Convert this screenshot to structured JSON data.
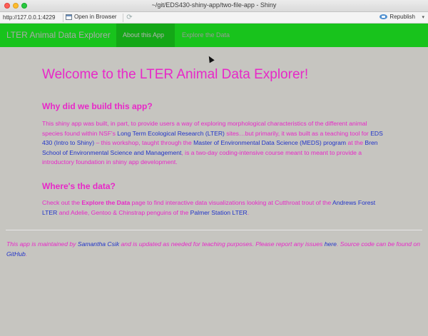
{
  "window": {
    "title": "~/git/EDS430-shiny-app/two-file-app - Shiny"
  },
  "toolbar": {
    "url": "http://127.0.0.1:4229",
    "open_in_browser": "Open in Browser",
    "republish": "Republish"
  },
  "navbar": {
    "brand": "LTER Animal Data Explorer",
    "tabs": [
      {
        "label": "About this App",
        "active": true
      },
      {
        "label": "Explore the Data",
        "active": false
      }
    ]
  },
  "main": {
    "heading": "Welcome to the LTER Animal Data Explorer!",
    "section1": {
      "title": "Why did we build this app?",
      "t1": "This shiny app was built, in part, to provide users a way of exploring morphological characteristics of the different animal species found within NSF's ",
      "l1": "Long Term Ecological Research (LTER)",
      "t2": " sites…but primarily, it was built as a teaching tool for ",
      "l2": "EDS 430 (Intro to Shiny)",
      "t3": " – this workshop, taught through the ",
      "l3": "Master of Environmental Data Science (MEDS) program",
      "t4": " at the ",
      "l4": "Bren School of Environmental Science and Management",
      "t5": ", is a two-day coding-intensive course meant to meant to provide a introductory foundation in shiny app development."
    },
    "section2": {
      "title": "Where's the data?",
      "t1": "Check out the ",
      "b1": "Explore the Data",
      "t2": " page to find interactive data visualizations looking at Cutthroat trout of the ",
      "l1": "Andrews Forest LTER",
      "t3": " and Adelie, Gentoo & Chinstrap penguins of the ",
      "l2": "Palmer Station LTER",
      "t4": "."
    }
  },
  "footer": {
    "t1": "This app is maintained by ",
    "l1": "Samantha Csik",
    "t2": " and is updated as needed for teaching purposes. Please report any issues ",
    "l2": "here",
    "t3": ". Source code can be found on ",
    "l3": "GitHub",
    "t4": "."
  },
  "colors": {
    "navbar": "#18c31c",
    "active_tab": "#14a717",
    "background": "#c6c5c0",
    "text_accent": "#e828c8",
    "link": "#2134c9"
  }
}
